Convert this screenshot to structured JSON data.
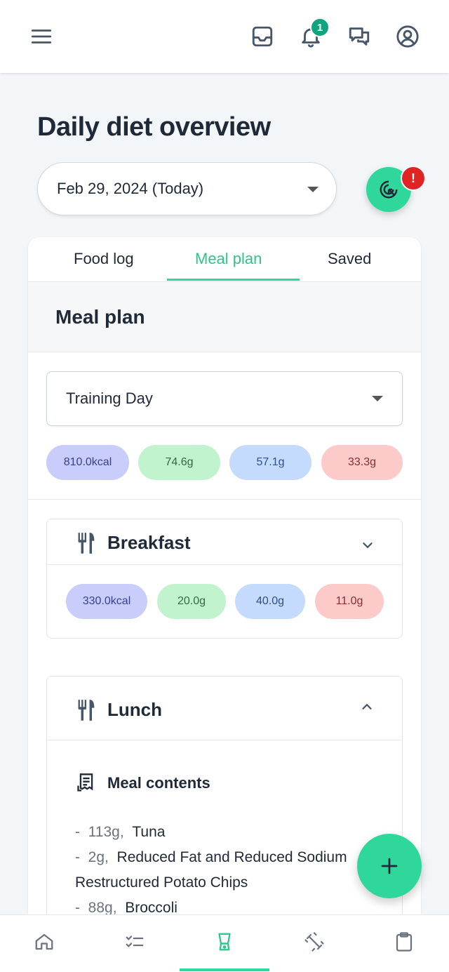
{
  "header": {
    "notification_count": "1"
  },
  "page": {
    "title": "Daily diet overview",
    "date_value": "Feb 29, 2024 (Today)",
    "alert_badge": "!"
  },
  "tabs": [
    {
      "label": "Food log"
    },
    {
      "label": "Meal plan"
    },
    {
      "label": "Saved"
    }
  ],
  "meal_plan": {
    "title": "Meal plan",
    "selected_plan": "Training Day",
    "totals": {
      "kcal": "810.0kcal",
      "protein": "74.6g",
      "carbs": "57.1g",
      "fat": "33.3g"
    }
  },
  "meals": {
    "breakfast": {
      "name": "Breakfast",
      "totals": {
        "kcal": "330.0kcal",
        "protein": "20.0g",
        "carbs": "40.0g",
        "fat": "11.0g"
      }
    },
    "lunch": {
      "name": "Lunch",
      "contents_title": "Meal contents",
      "items": [
        {
          "qty": "113g,",
          "name": "Tuna"
        },
        {
          "qty": "2g,",
          "name": "Reduced Fat and Reduced Sodium"
        },
        {
          "qty": "",
          "name": "Restructured Potato Chips"
        },
        {
          "qty": "88g,",
          "name": "Broccoli"
        }
      ]
    }
  },
  "colors": {
    "accent": "#2fd89a",
    "kcal_pill": "#c8cdfc",
    "protein_pill": "#c1f3cf",
    "carbs_pill": "#c5dbfd",
    "fat_pill": "#fdcaca",
    "alert": "#e02424"
  },
  "icons": {
    "menu": "menu-icon",
    "inbox": "inbox-icon",
    "bell": "bell-icon",
    "chat": "chat-icon",
    "user": "user-icon",
    "target": "target-cursor-icon",
    "fork_knife": "fork-knife-icon",
    "receipt": "receipt-icon",
    "add": "plus-icon",
    "nav": [
      "home-icon",
      "checklist-icon",
      "blender-icon",
      "dumbbell-icon",
      "clipboard-icon"
    ]
  }
}
